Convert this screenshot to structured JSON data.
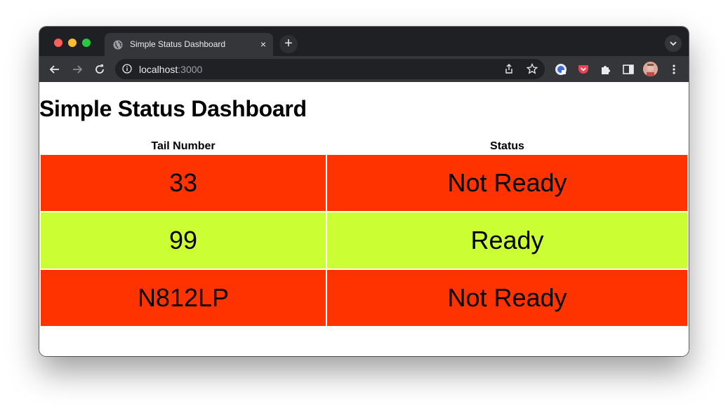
{
  "browser": {
    "tab": {
      "title": "Simple Status Dashboard",
      "close_label": "×"
    },
    "new_tab_label": "+",
    "address": {
      "host": "localhost",
      "port": ":3000"
    }
  },
  "page": {
    "title": "Simple Status Dashboard",
    "table": {
      "headers": [
        "Tail Number",
        "Status"
      ],
      "rows": [
        {
          "tail": "33",
          "status": "Not Ready",
          "color": "#ff3300"
        },
        {
          "tail": "99",
          "status": "Ready",
          "color": "#ccff33"
        },
        {
          "tail": "N812LP",
          "status": "Not Ready",
          "color": "#ff3300"
        }
      ]
    }
  },
  "colors": {
    "not_ready": "#ff3300",
    "ready": "#ccff33",
    "chrome_dark": "#1f2023",
    "chrome_toolbar": "#35363a"
  }
}
